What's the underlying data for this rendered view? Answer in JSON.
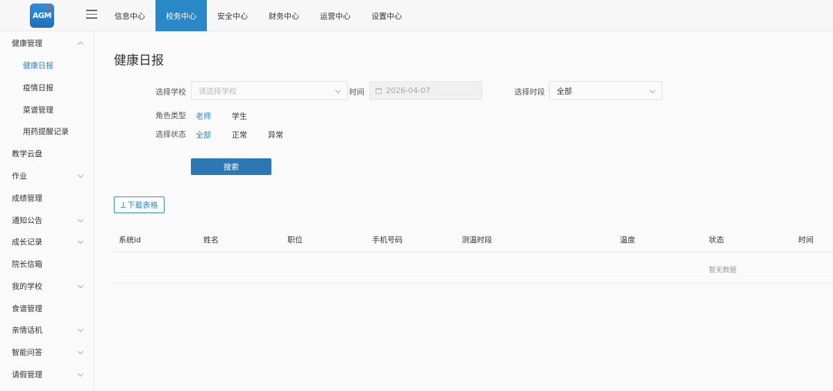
{
  "header": {
    "logo_text": "AGM",
    "nav": [
      {
        "label": "信息中心",
        "active": false
      },
      {
        "label": "校务中心",
        "active": true
      },
      {
        "label": "安全中心",
        "active": false
      },
      {
        "label": "财务中心",
        "active": false
      },
      {
        "label": "运营中心",
        "active": false
      },
      {
        "label": "设置中心",
        "active": false
      }
    ]
  },
  "sidebar": {
    "items": [
      {
        "label": "健康管理",
        "expandable": true,
        "expanded": true
      },
      {
        "label": "健康日报",
        "sub": true,
        "active": true
      },
      {
        "label": "疫情日报",
        "sub": true
      },
      {
        "label": "菜谱管理",
        "sub": true
      },
      {
        "label": "用药提醒记录",
        "sub": true
      },
      {
        "label": "教学云盘"
      },
      {
        "label": "作业",
        "expandable": true
      },
      {
        "label": "成绩管理"
      },
      {
        "label": "通知公告",
        "expandable": true
      },
      {
        "label": "成长记录",
        "expandable": true
      },
      {
        "label": "院长信箱"
      },
      {
        "label": "我的学校",
        "expandable": true
      },
      {
        "label": "食谱管理"
      },
      {
        "label": "亲情话机",
        "expandable": true
      },
      {
        "label": "智能问答",
        "expandable": true
      },
      {
        "label": "请假管理",
        "expandable": true
      }
    ]
  },
  "main": {
    "title": "健康日报",
    "filters": {
      "school_label": "选择学校",
      "school_placeholder": "请选择学校",
      "time_label": "时间",
      "date_value": "2026-04-07",
      "period_label": "选择时段",
      "period_value": "全部",
      "role_label": "角色类型",
      "role_options": [
        "老师",
        "学生"
      ],
      "role_selected": "老师",
      "status_label": "选择状态",
      "status_options": [
        "全部",
        "正常",
        "异常"
      ],
      "status_selected": "全部"
    },
    "search_button": "搜索",
    "download_button": "下载表格",
    "table": {
      "columns": [
        "系统id",
        "姓名",
        "职位",
        "手机号码",
        "测温时段",
        "温度",
        "状态",
        "时间"
      ],
      "empty_text": "暂无数据"
    }
  },
  "colors": {
    "accent": "#2b88c7",
    "button": "#2b78b4"
  }
}
